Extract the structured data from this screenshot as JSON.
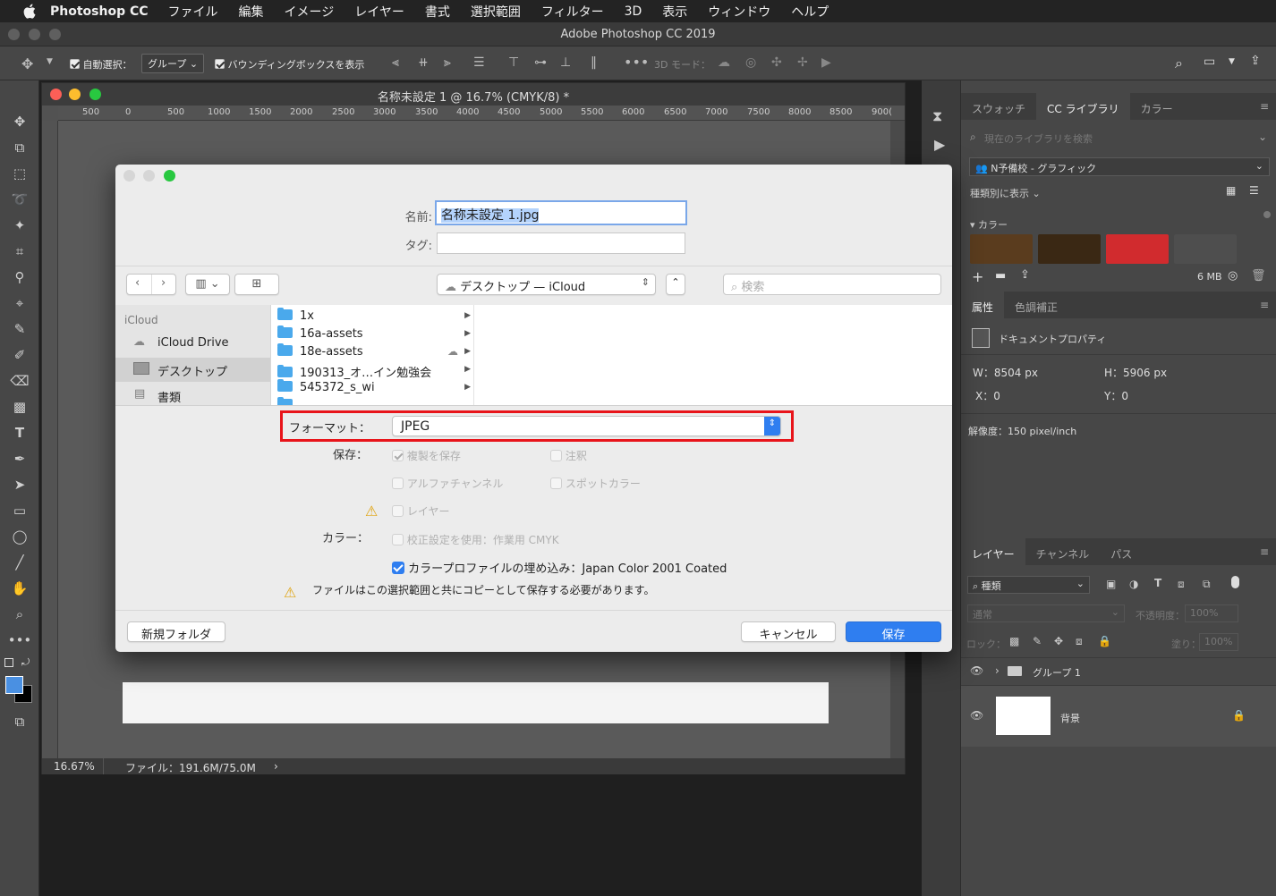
{
  "menubar": {
    "app_name": "Photoshop CC",
    "items": [
      "ファイル",
      "編集",
      "イメージ",
      "レイヤー",
      "書式",
      "選択範囲",
      "フィルター",
      "3D",
      "表示",
      "ウィンドウ",
      "ヘルプ"
    ]
  },
  "app_title": "Adobe Photoshop CC 2019",
  "options_bar": {
    "auto_select_label": "自動選択：",
    "auto_select_value": "グループ",
    "bounding_box_label": "バウンディングボックスを表示",
    "mode_3d_label": "3D モード："
  },
  "document": {
    "title": "名称未設定 1 @ 16.7% (CMYK/8) *",
    "ruler_ticks": [
      "500",
      "0",
      "500",
      "1000",
      "1500",
      "2000",
      "2500",
      "3000",
      "3500",
      "4000",
      "4500",
      "5000",
      "5500",
      "6000",
      "6500",
      "7000",
      "7500",
      "8000",
      "8500",
      "900("
    ],
    "zoom": "16.67%",
    "file_info": "ファイル：191.6M/75.0M"
  },
  "dialog": {
    "name_label": "名前:",
    "name_value": "名称未設定 1.jpg",
    "tag_label": "タグ:",
    "location": "デスクトップ — iCloud",
    "search_placeholder": "検索",
    "sidebar": {
      "section": "iCloud",
      "items": [
        "iCloud Drive",
        "デスクトップ",
        "書類"
      ]
    },
    "files": [
      "1x",
      "16a-assets",
      "18e-assets",
      "190313_オ…イン勉強会",
      "545372_s_wi"
    ],
    "format_label": "フォーマット：",
    "format_value": "JPEG",
    "save_label": "保存：",
    "options": {
      "copy": "複製を保存",
      "notes": "注釈",
      "alpha": "アルファチャンネル",
      "spot": "スポットカラー",
      "layers": "レイヤー",
      "color_label": "カラー：",
      "proof": "校正設定を使用：作業用 CMYK",
      "profile": "カラープロファイルの埋め込み：Japan Color 2001 Coated"
    },
    "warning": "ファイルはこの選択範囲と共にコピーとして保存する必要があります。",
    "new_folder": "新規フォルダ",
    "cancel": "キャンセル",
    "save": "保存"
  },
  "right_panel": {
    "tabs_top": [
      "スウォッチ",
      "CC ライブラリ",
      "カラー"
    ],
    "search_placeholder": "現在のライブラリを検索",
    "library_name": "N予備校 - グラフィック",
    "view_by": "種類別に表示",
    "colors_section": "カラー",
    "swatch_colors": [
      "#5a3c1e",
      "#3a2814",
      "#d12b2e",
      "#4e4e4e"
    ],
    "storage": "6 MB",
    "props_tabs": [
      "属性",
      "色調補正"
    ],
    "doc_props": "ドキュメントプロパティ",
    "w": "W：8504 px",
    "h": "H：5906 px",
    "x": "X：0",
    "y": "Y：0",
    "resolution": "解像度：150 pixel/inch",
    "layer_tabs": [
      "レイヤー",
      "チャンネル",
      "パス"
    ],
    "kind": "種類",
    "blend": "通常",
    "opacity_label": "不透明度：",
    "opacity": "100%",
    "lock_label": "ロック：",
    "fill_label": "塗り：",
    "fill": "100%",
    "layers": [
      "グループ 1",
      "背景"
    ]
  }
}
